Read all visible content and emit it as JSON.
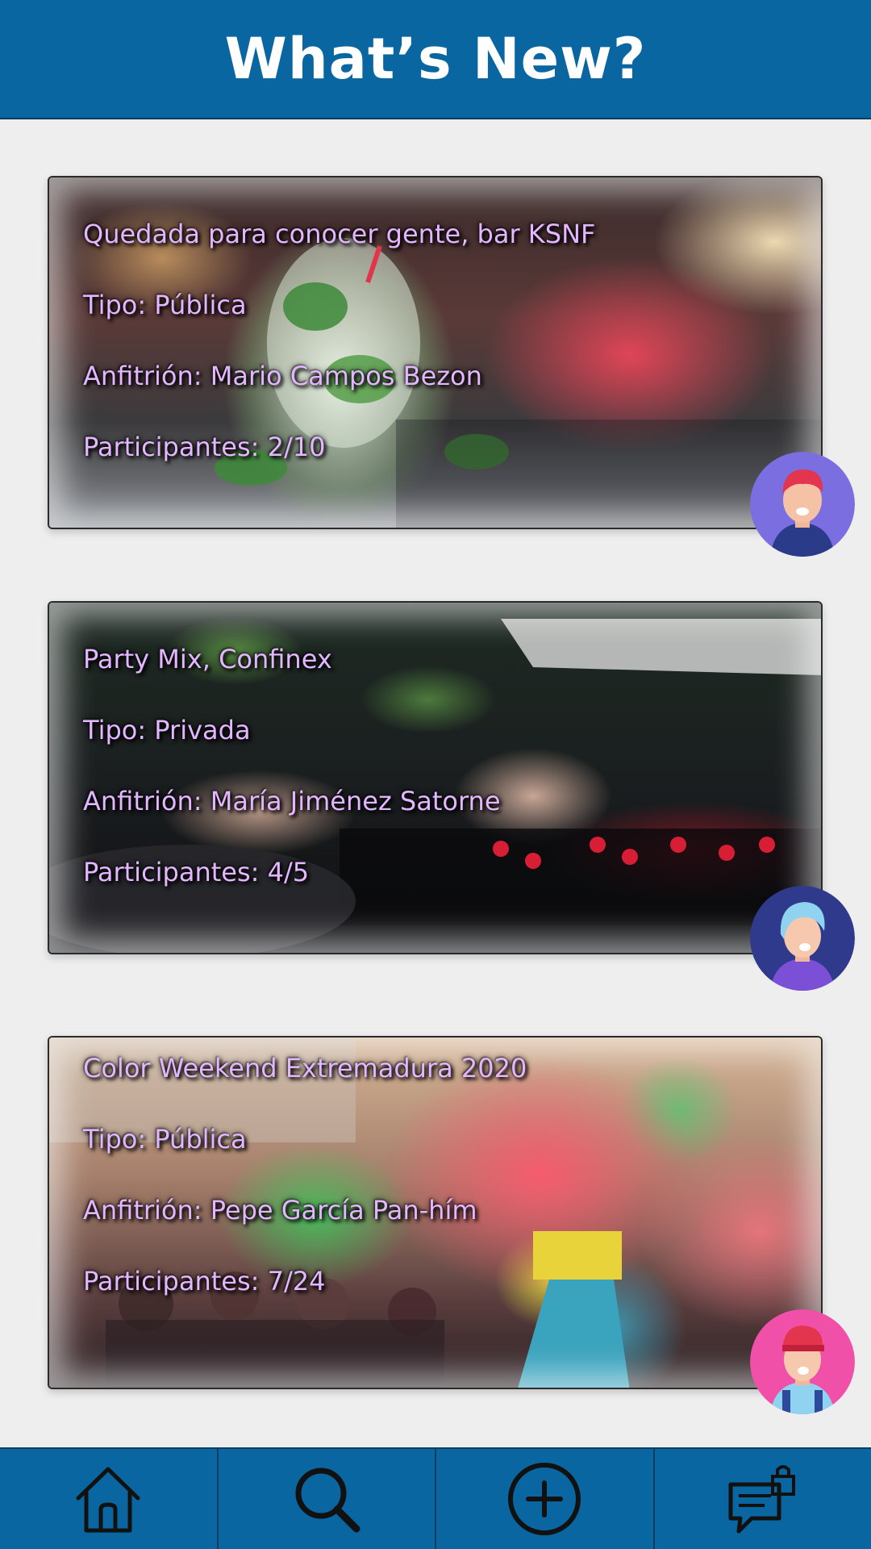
{
  "header": {
    "title": "What’s New?"
  },
  "events": [
    {
      "title": "Quedada para conocer gente, bar KSNF",
      "type": "Tipo: Pública",
      "host": "Anfitrión: Mario Campos Bezon",
      "participants": "Participantes: 2/10",
      "image": "mojito-bar-photo",
      "avatar": "avatar-red-hair-man"
    },
    {
      "title": "Party Mix, Confinex",
      "type": "Tipo: Privada",
      "host": "Anfitrión: María Jiménez Satorne",
      "participants": "Participantes: 4/5",
      "image": "dj-mixer-photo",
      "avatar": "avatar-blue-hair-woman"
    },
    {
      "title": "Color Weekend Extremadura 2020",
      "type": "Tipo: Pública",
      "host": "Anfitrión: Pepe García Pan-hím",
      "participants": "Participantes: 7/24",
      "image": "color-festival-photo",
      "avatar": "avatar-red-cap-man"
    }
  ],
  "nav": {
    "items": [
      "home-icon",
      "search-icon",
      "add-circle-icon",
      "chat-lock-icon"
    ]
  },
  "colors": {
    "header_bg": "#0a66a0",
    "card_text": "#e3b6ff",
    "background": "#eeeeee"
  }
}
